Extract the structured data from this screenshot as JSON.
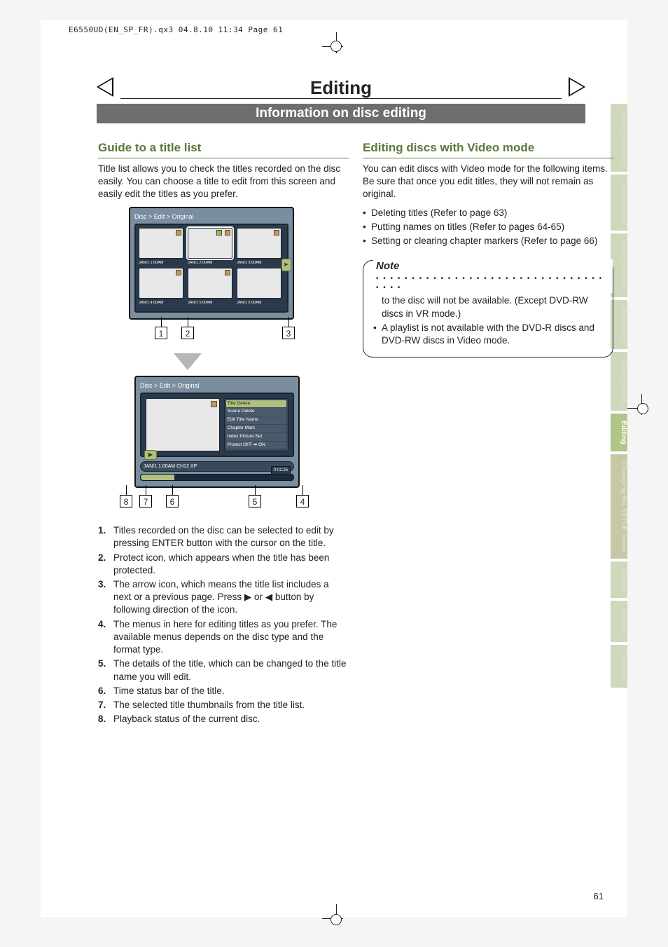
{
  "crop_header": "E6550UD(EN_SP_FR).qx3  04.8.10  11:34  Page 61",
  "title": "Editing",
  "section_bar": "Information on disc editing",
  "page_number": "61",
  "side_tabs": [
    "Before you start",
    "Connections",
    "Getting started",
    "Recording",
    "Playing discs",
    "Editing",
    "Changing the SETUP menu",
    "Others",
    "Español",
    "Français"
  ],
  "left": {
    "heading": "Guide to a title list",
    "intro": "Title list allows you to check the titles recorded on the disc easily. You can choose a title to edit from this screen and easily edit the titles as you prefer.",
    "screen_title": "Disc > Edit > Original",
    "thumbs": [
      "JAN/1  1:00AM",
      "JAN/1  2:00AM",
      "JAN/1  3:00AM",
      "JAN/1  4:00AM",
      "JAN/1  5:00AM",
      "JAN/1  6:00AM"
    ],
    "callouts_1": [
      "1",
      "2",
      "3"
    ],
    "screen2_title": "Disc > Edit > Original",
    "menu": [
      "Title Delete",
      "Scene Delete",
      "Edit Title Name",
      "Chapter Mark",
      "Index Picture Set",
      "Protect OFF ➡ ON"
    ],
    "status": "JAN/1  1:00AM  CH12    XP",
    "progress_time": "0:01:25",
    "callouts_2": [
      "8",
      "7",
      "6",
      "5",
      "4"
    ],
    "list": [
      "Titles recorded on the disc can be selected to edit by pressing ENTER button with the cursor on the title.",
      "Protect icon, which appears when the title has been protected.",
      "The arrow icon, which means the title list includes a next or a previous page. Press ▶ or ◀ button by following direction of the icon.",
      "The menus in here for editing titles as you prefer. The available menus depends on the disc type and the format type.",
      "The details of the title, which can be changed to the title name you will edit.",
      "Time status bar of the title.",
      "The selected title thumbnails from the title list.",
      "Playback status of the current disc."
    ]
  },
  "right": {
    "heading": "Editing discs with Video mode",
    "intro": "You can edit discs with Video mode for the following items. Be sure that once you edit titles, they will not remain as original.",
    "bullets": [
      "Deleting titles (Refer to page 63)",
      "Putting names on titles (Refer to pages 64-65)",
      "Setting or clearing chapter markers (Refer to page 66)"
    ],
    "note_label": "Note",
    "note_items": [
      "Once a disc is finalized, editing the disc or recording to the disc will not be available. (Except DVD-RW discs in VR mode.)",
      "A playlist is not available with the DVD-R discs and DVD-RW discs in Video mode."
    ]
  }
}
